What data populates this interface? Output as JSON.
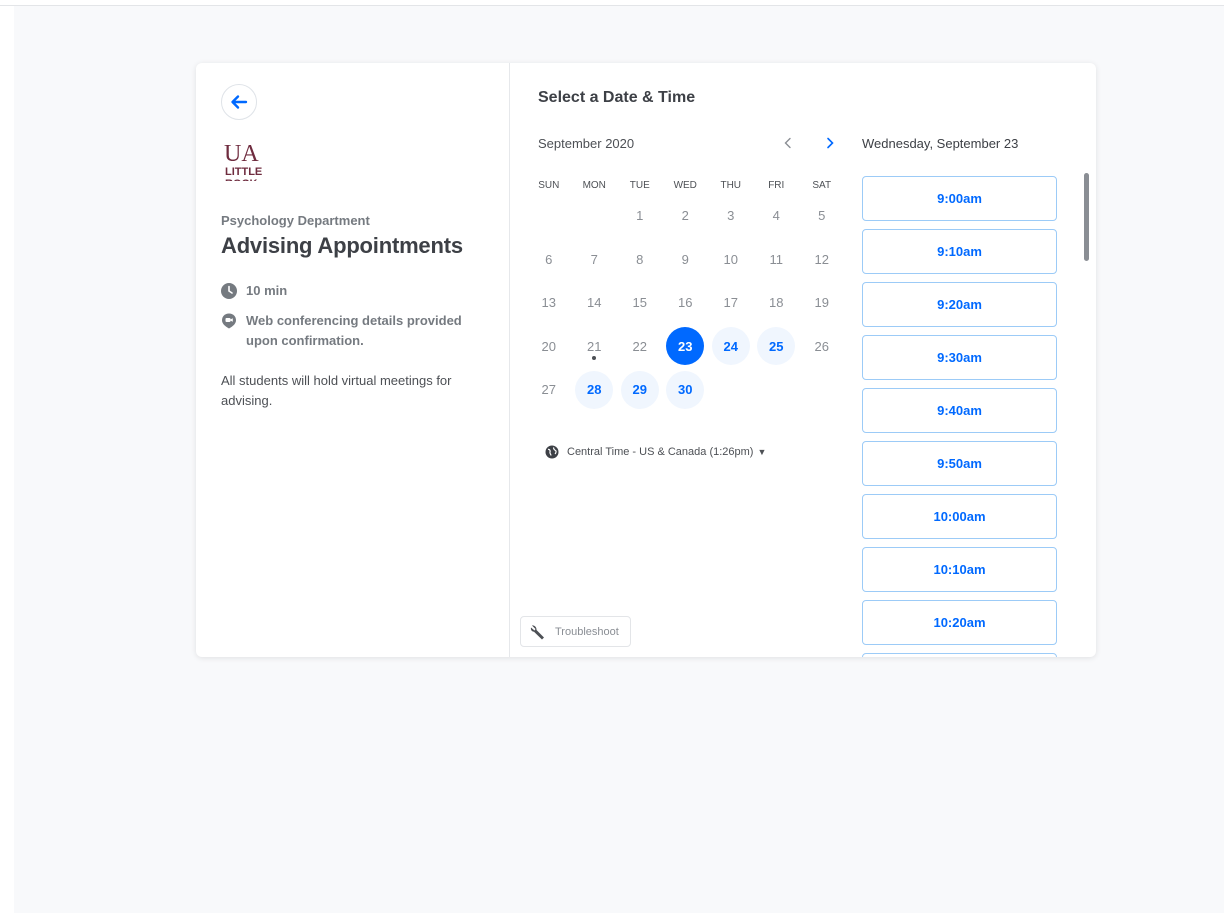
{
  "left": {
    "org_name": "Psychology Department",
    "event_title": "Advising Appointments",
    "logo_text": [
      "UA",
      "LITTLE",
      "ROCK"
    ],
    "duration": "10 min",
    "location_line1": "Web conferencing details provided",
    "location_line2": "upon confirmation.",
    "description_line1": "All students will hold virtual meetings for",
    "description_line2": "advising."
  },
  "calendar": {
    "title": "Select a Date & Time",
    "month": "September 2020",
    "weekdays": [
      "SUN",
      "MON",
      "TUE",
      "WED",
      "THU",
      "FRI",
      "SAT"
    ],
    "days": [
      {
        "label": "",
        "state": "blank"
      },
      {
        "label": "",
        "state": "blank"
      },
      {
        "label": "1",
        "state": "off"
      },
      {
        "label": "2",
        "state": "off"
      },
      {
        "label": "3",
        "state": "off"
      },
      {
        "label": "4",
        "state": "off"
      },
      {
        "label": "5",
        "state": "off"
      },
      {
        "label": "6",
        "state": "off"
      },
      {
        "label": "7",
        "state": "off"
      },
      {
        "label": "8",
        "state": "off"
      },
      {
        "label": "9",
        "state": "off"
      },
      {
        "label": "10",
        "state": "off"
      },
      {
        "label": "11",
        "state": "off"
      },
      {
        "label": "12",
        "state": "off"
      },
      {
        "label": "13",
        "state": "off"
      },
      {
        "label": "14",
        "state": "off"
      },
      {
        "label": "15",
        "state": "off"
      },
      {
        "label": "16",
        "state": "off"
      },
      {
        "label": "17",
        "state": "off"
      },
      {
        "label": "18",
        "state": "off"
      },
      {
        "label": "19",
        "state": "off"
      },
      {
        "label": "20",
        "state": "off"
      },
      {
        "label": "21",
        "state": "today"
      },
      {
        "label": "22",
        "state": "off"
      },
      {
        "label": "23",
        "state": "selected"
      },
      {
        "label": "24",
        "state": "avail"
      },
      {
        "label": "25",
        "state": "avail"
      },
      {
        "label": "26",
        "state": "off"
      },
      {
        "label": "27",
        "state": "off"
      },
      {
        "label": "28",
        "state": "avail"
      },
      {
        "label": "29",
        "state": "avail"
      },
      {
        "label": "30",
        "state": "avail"
      }
    ],
    "timezone": "Central Time - US & Canada (1:26pm)"
  },
  "times": {
    "date_heading": "Wednesday, September 23",
    "slots": [
      "9:00am",
      "9:10am",
      "9:20am",
      "9:30am",
      "9:40am",
      "9:50am",
      "10:00am",
      "10:10am",
      "10:20am",
      ""
    ]
  },
  "troubleshoot_label": "Troubleshoot",
  "colors": {
    "accent": "#0069ff",
    "accent_light": "#f0f6fe",
    "slot_border": "#9ccbf7",
    "logo_maroon": "#6f2c3f"
  }
}
